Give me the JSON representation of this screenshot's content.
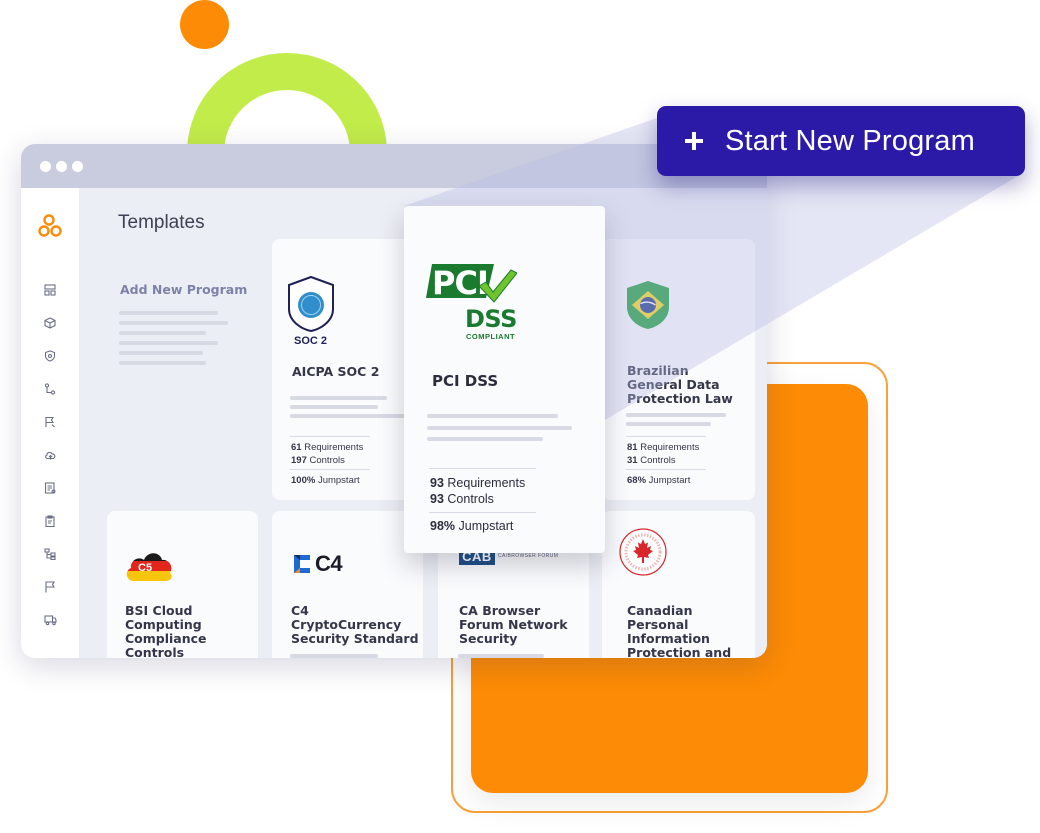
{
  "cta": {
    "label": "Start New Program"
  },
  "templates_title": "Templates",
  "add_new": {
    "title": "Add New Program"
  },
  "sidebar_icons": [
    "dashboard-icon",
    "cube-icon",
    "shield-icon",
    "workflow-icon",
    "flag-edit-icon",
    "cloud-upload-icon",
    "report-icon",
    "clipboard-icon",
    "hierarchy-icon",
    "flag-icon",
    "truck-icon"
  ],
  "cards": {
    "soc2": {
      "badge_text": "SOC 2",
      "title": "AICPA SOC 2",
      "req_num": "61",
      "req_label": "Requirements",
      "ctrl_num": "197",
      "ctrl_label": "Controls",
      "jump_num": "100%",
      "jump_label": "Jumpstart"
    },
    "pci": {
      "logo_pci": "PCI",
      "logo_dss": "DSS",
      "logo_compliant": "COMPLIANT",
      "title": "PCI DSS",
      "req_num": "93",
      "req_label": "Requirements",
      "ctrl_num": "93",
      "ctrl_label": "Controls",
      "jump_num": "98%",
      "jump_label": "Jumpstart"
    },
    "lgpd": {
      "title_line1": "Brazilian",
      "title_line2": "General Data",
      "title_line3": "Protection Law",
      "req_num": "81",
      "req_label": "Requirements",
      "ctrl_num": "31",
      "ctrl_label": "Controls",
      "jump_num": "68%",
      "jump_label": "Jumpstart"
    },
    "c5": {
      "badge_text": "C5",
      "title_line1": "BSI Cloud",
      "title_line2": "Computing",
      "title_line3": "Compliance",
      "title_line4": "Controls"
    },
    "c4": {
      "logo_text": "C4",
      "title_line1": "C4",
      "title_line2": "CryptoCurrency",
      "title_line3": "Security Standard"
    },
    "cab": {
      "logo_text": "CAB",
      "logo_sub": "CA/BROWSER FORUM",
      "title_line1": "CA Browser",
      "title_line2": "Forum Network",
      "title_line3": "Security"
    },
    "pipeda": {
      "title_line1": "Canadian",
      "title_line2": "Personal",
      "title_line3": "Information",
      "title_line4": "Protection and"
    }
  },
  "colors": {
    "accent": "#2b1aa8",
    "orange": "#fd8b05",
    "lime": "#c2ec4a",
    "pci_green": "#1a7a2e",
    "text": "#34364a"
  }
}
